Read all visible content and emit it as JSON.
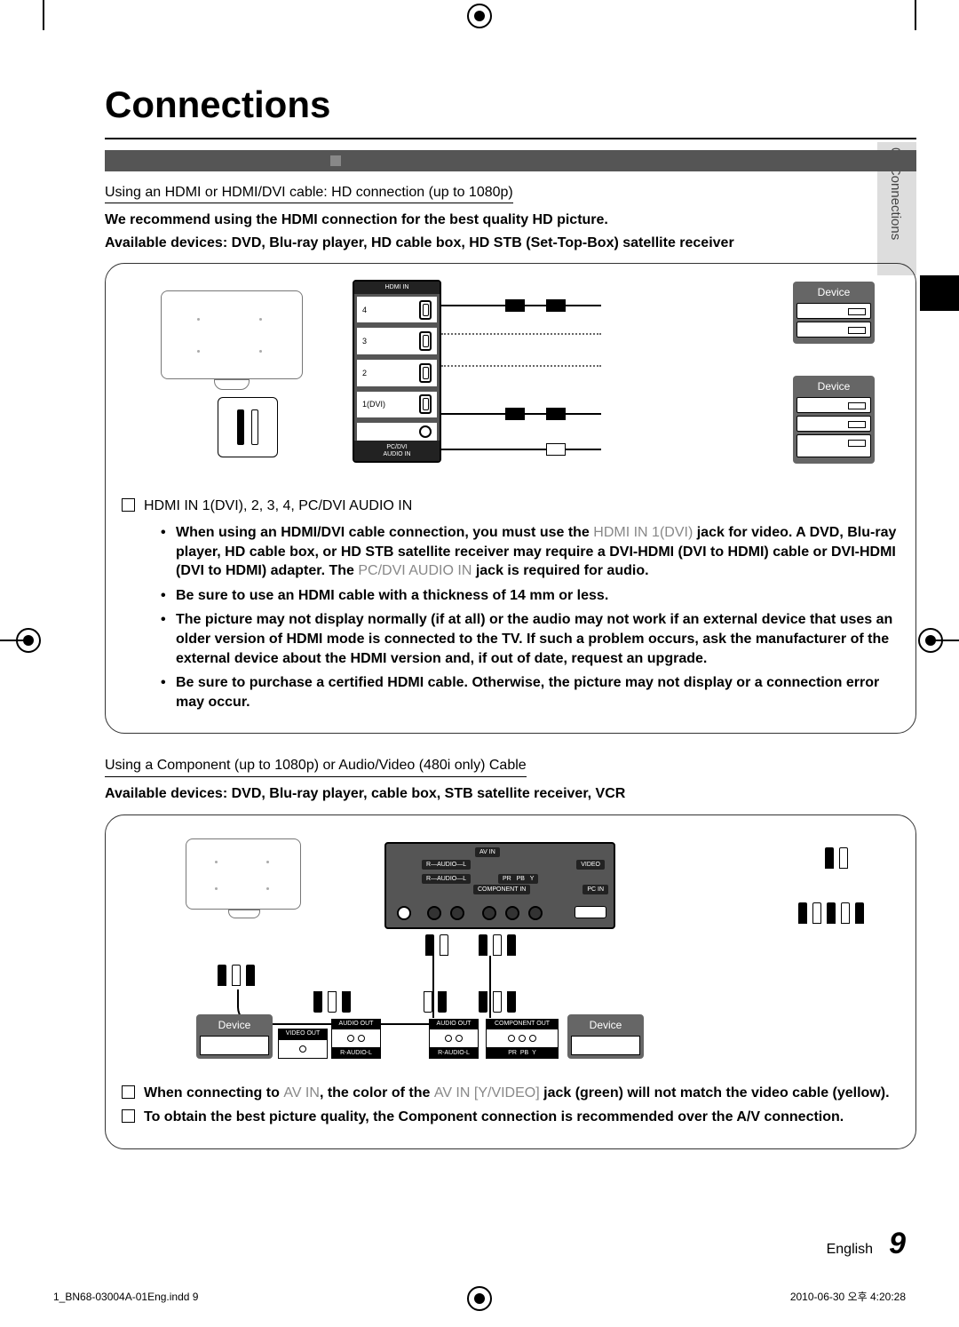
{
  "side_tab": "02  Connections",
  "title": "Connections",
  "section1": {
    "heading": "Using an HDMI or HDMI/DVI cable: HD connection (up to 1080p)",
    "line1": "We recommend using the HDMI connection for the best quality HD picture.",
    "line2": "Available devices: DVD, Blu-ray player, HD cable box, HD STB (Set-Top-Box) satellite receiver",
    "diagram": {
      "panel_header": "HDMI IN",
      "ports": [
        "4",
        "3",
        "2",
        "1(DVI)"
      ],
      "panel_footer": "PC/DVI\nAUDIO IN",
      "device_label": "Device"
    },
    "check_label": "HDMI IN 1(DVI), 2, 3, 4, PC/DVI AUDIO IN",
    "bullets": [
      {
        "pre": "When using an HDMI/DVI cable connection, you must use the ",
        "gray": "HDMI IN 1(DVI)",
        "post": " jack for video. A DVD, Blu-ray player, HD cable box, or HD STB satellite receiver may require a DVI-HDMI (DVI to HDMI) cable or DVI-HDMI (DVI to HDMI) adapter. The ",
        "gray2": "PC/DVI AUDIO IN",
        "post2": " jack is required for audio."
      },
      {
        "text": "Be sure to use an HDMI cable with a thickness of 14 mm or less."
      },
      {
        "text": "The picture may not display normally (if at all) or the audio may not work if an external device that uses an older version of HDMI mode is connected to the TV. If such a problem occurs, ask the manufacturer of the external device about the HDMI version and, if out of date, request an upgrade."
      },
      {
        "text": "Be sure to purchase a certified HDMI cable. Otherwise, the picture may not display or a connection error may occur."
      }
    ]
  },
  "section2": {
    "heading": "Using a Component (up to 1080p) or Audio/Video (480i only) Cable",
    "line1": "Available devices: DVD, Blu-ray player, cable box, STB satellite receiver, VCR",
    "diagram": {
      "av_in": "AV IN",
      "audio": "AUDIO",
      "r": "R",
      "l": "L",
      "video": "VIDEO",
      "component_in": "COMPONENT IN",
      "pr": "PR",
      "pb": "PB",
      "y": "Y",
      "pc_in": "PC IN",
      "device_label": "Device",
      "video_out": "VIDEO OUT",
      "audio_out": "AUDIO OUT",
      "component_out": "COMPONENT OUT",
      "r_audio_l": "R-AUDIO-L"
    },
    "notes": [
      {
        "pre": "When connecting to ",
        "g1": "AV IN",
        "mid": ", the color of the ",
        "g2": "AV IN [Y/VIDEO]",
        "post": " jack (green) will not match the video cable (yellow)."
      },
      {
        "text": "To obtain the best picture quality, the Component connection is recommended over the A/V connection."
      }
    ]
  },
  "footer": {
    "lang": "English",
    "page": "9",
    "left": "1_BN68-03004A-01Eng.indd   9",
    "right": "2010-06-30   오후 4:20:28"
  }
}
